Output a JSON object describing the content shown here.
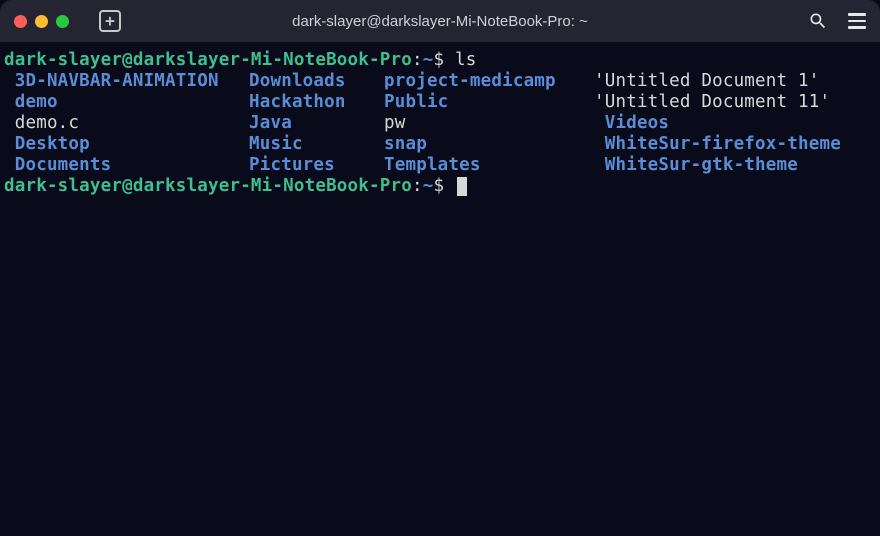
{
  "window": {
    "title": "dark-slayer@darkslayer-Mi-NoteBook-Pro: ~"
  },
  "prompt": {
    "user_host": "dark-slayer@darkslayer-Mi-NoteBook-Pro",
    "separator": ":",
    "path": "~",
    "symbol": "$"
  },
  "command": "ls",
  "ls_output": {
    "rows": [
      [
        {
          "name": " 3D-NAVBAR-ANIMATION",
          "type": "dir"
        },
        {
          "name": "Downloads",
          "type": "dir"
        },
        {
          "name": "project-medicamp",
          "type": "dir"
        },
        {
          "name": "'Untitled Document 1'",
          "type": "file"
        }
      ],
      [
        {
          "name": " demo",
          "type": "dir"
        },
        {
          "name": "Hackathon",
          "type": "dir"
        },
        {
          "name": "Public",
          "type": "dir"
        },
        {
          "name": "'Untitled Document 11'",
          "type": "file"
        }
      ],
      [
        {
          "name": " demo.c",
          "type": "file"
        },
        {
          "name": "Java",
          "type": "dir"
        },
        {
          "name": "pw",
          "type": "file"
        },
        {
          "name": " Videos",
          "type": "dir"
        }
      ],
      [
        {
          "name": " Desktop",
          "type": "dir"
        },
        {
          "name": "Music",
          "type": "dir"
        },
        {
          "name": "snap",
          "type": "dir"
        },
        {
          "name": " WhiteSur-firefox-theme",
          "type": "dir"
        }
      ],
      [
        {
          "name": " Documents",
          "type": "dir"
        },
        {
          "name": "Pictures",
          "type": "dir"
        },
        {
          "name": "Templates",
          "type": "dir"
        },
        {
          "name": " WhiteSur-gtk-theme",
          "type": "dir"
        }
      ]
    ]
  }
}
